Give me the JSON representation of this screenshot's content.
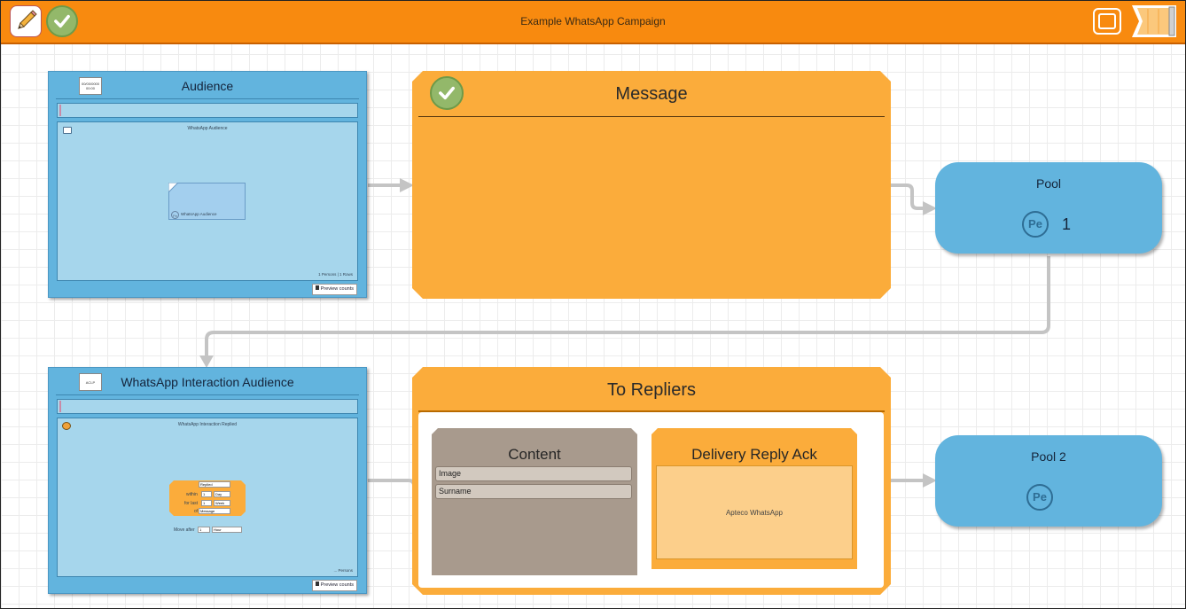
{
  "colors": {
    "toolbar": "#f88a0f",
    "audience_blue": "#62b4de",
    "message_orange": "#fbac3b",
    "content_taupe": "#a89a8d"
  },
  "toolbar": {
    "title": "Example WhatsApp Campaign",
    "edit_icon": "pencil-icon",
    "check_icon": "check-icon",
    "window_icon": "window-icon",
    "ribbon_icon": "ribbon-icon"
  },
  "audience1": {
    "title": "Audience",
    "date_line1": "00/00/0000",
    "date_line2": "00:00",
    "panel_label": "WhatsApp Audience",
    "doc_label": "WhatsApp Audience",
    "counts": "1 Persons | 1 Rows",
    "preview": "Preview counts",
    "pe": "Pe"
  },
  "message": {
    "title": "Message"
  },
  "pool1": {
    "title": "Pool",
    "pe": "Pe",
    "count": "1"
  },
  "audience2": {
    "title": "WhatsApp Interaction Audience",
    "cal_label": "ACLP",
    "panel_label": "WhatsApp Interaction Replied",
    "action_value": "Replied",
    "within_label": "within",
    "within_num": "1",
    "within_unit": "Day",
    "for_last_label": "for last",
    "for_last_num": "1",
    "for_last_unit": "Week",
    "of_label": "of",
    "of_value": "Message",
    "move_after_label": "Move after",
    "move_after_num": "1",
    "move_after_unit": "Hour",
    "counts": "... Persons",
    "preview": "Preview counts"
  },
  "repliers": {
    "title": "To Repliers",
    "content": {
      "title": "Content",
      "rows": [
        "Image",
        "Surname"
      ]
    },
    "delivery": {
      "title": "Delivery Reply Ack",
      "body": "Apteco WhatsApp"
    }
  },
  "pool2": {
    "title": "Pool 2",
    "pe": "Pe"
  }
}
